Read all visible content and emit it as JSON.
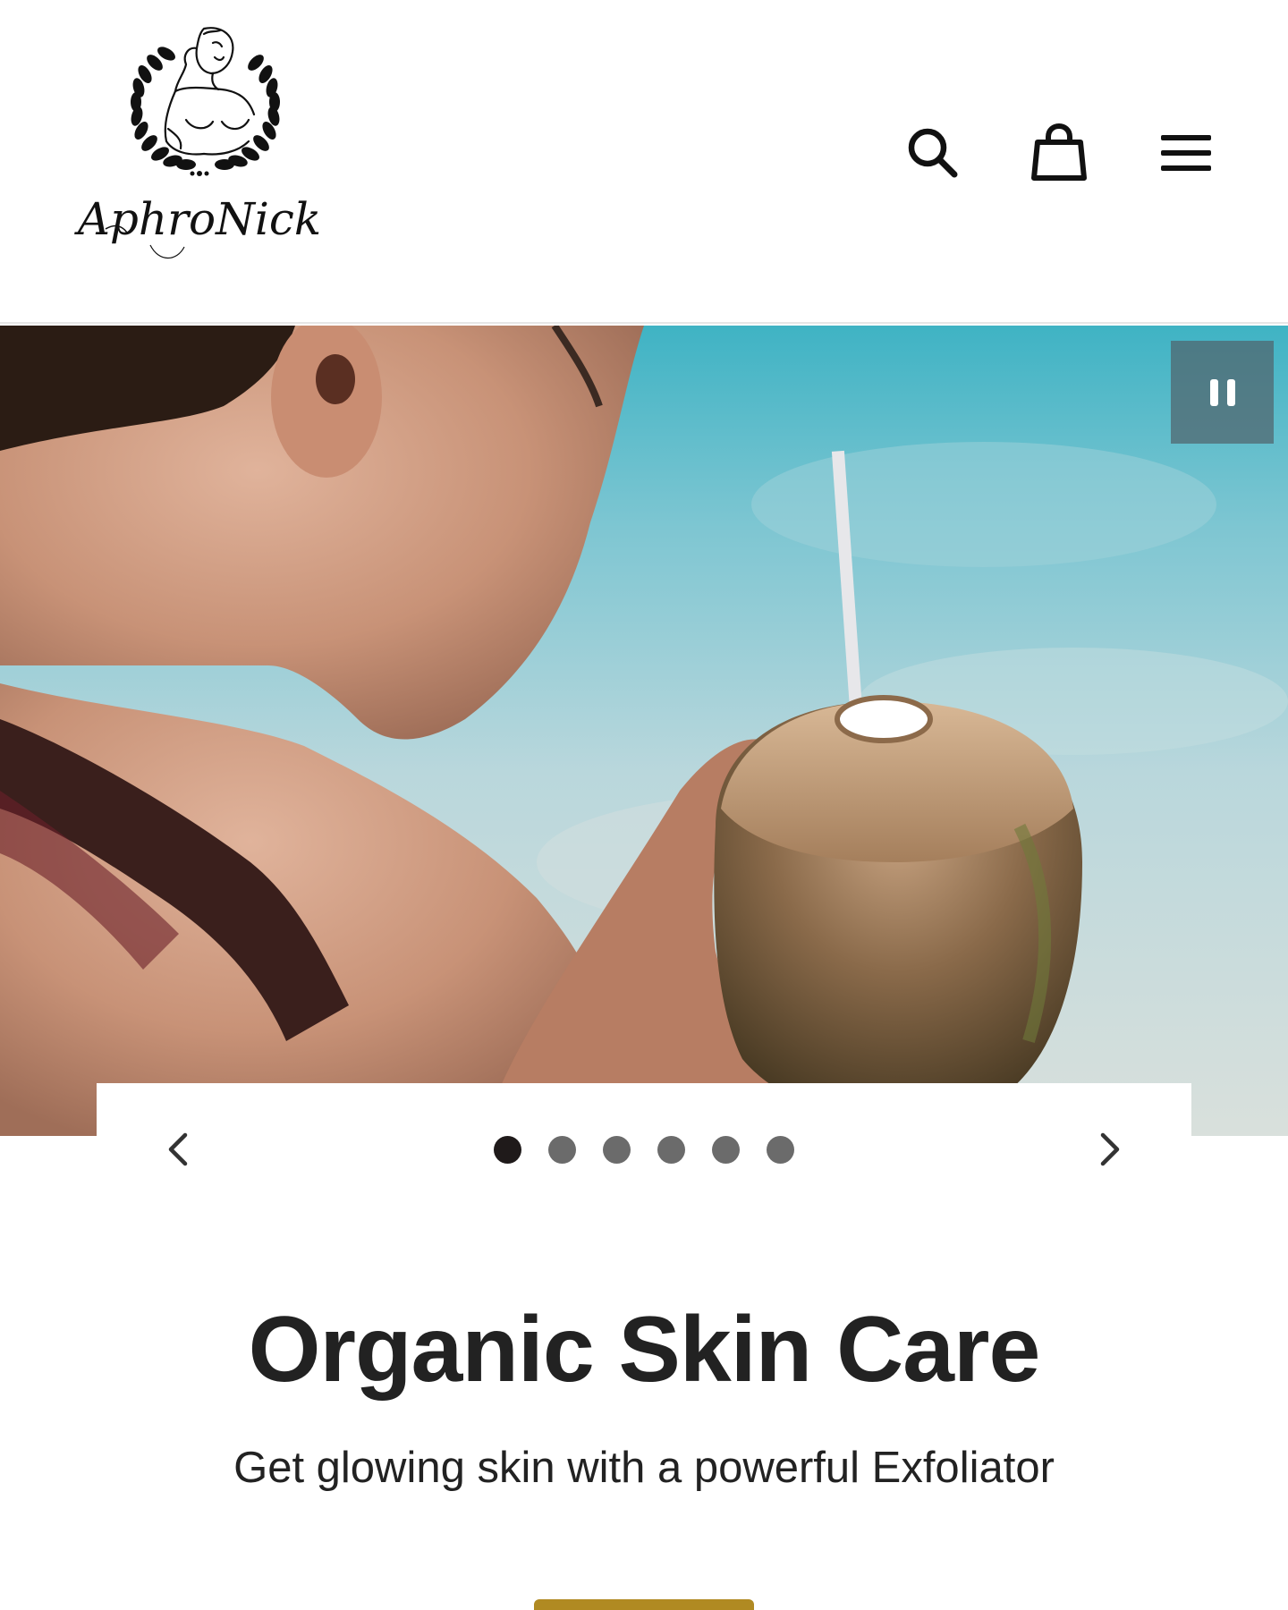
{
  "brand": {
    "logo_text": "AphroNick",
    "logo_icon": "goddess-emblem"
  },
  "header": {
    "icons": [
      "search-icon",
      "shopping-bag-icon",
      "hamburger-menu-icon"
    ]
  },
  "slideshow": {
    "slide_count": 6,
    "active_slide": 1,
    "pause_icon": "pause-icon",
    "prev_icon": "chevron-left-icon",
    "next_icon": "chevron-right-icon"
  },
  "hero": {
    "title": "Organic Skin Care",
    "subtitle": "Get glowing skin with a powerful Exfoliator"
  },
  "colors": {
    "accent": "#b08a22",
    "text": "#222222",
    "dot_active": "#1f1a1a",
    "dot_inactive": "#6b6b6b"
  }
}
